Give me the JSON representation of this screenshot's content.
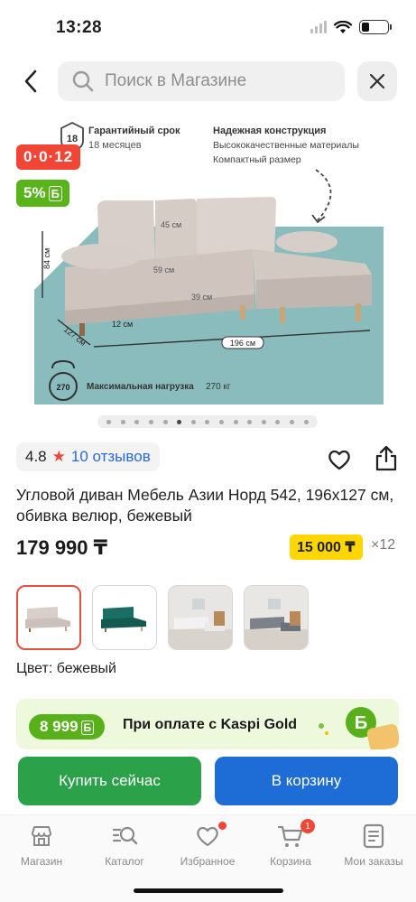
{
  "status_bar": {
    "time": "13:28"
  },
  "search": {
    "placeholder": "Поиск в Магазине"
  },
  "hero": {
    "installment_badge": "0·0·12",
    "bonus_badge": "5%",
    "bonus_symbol": "Б",
    "warranty_title": "Гарантийный срок",
    "warranty_value": "18 месяцев",
    "warranty_icon_text": "18",
    "construction_title": "Надежная конструкция",
    "construction_line1": "Высококачественные материалы",
    "construction_line2": "Компактный размер",
    "dim_height": "84 см",
    "dim_back": "45 см",
    "dim_seat_depth": "59 см",
    "dim_seat_height": "39 см",
    "dim_leg": "12 см",
    "dim_depth": "127 см",
    "dim_width": "196 см",
    "load_label": "Максимальная нагрузка",
    "load_value": "270 кг",
    "load_icon_text": "270",
    "slide_count": 15,
    "active_slide": 5
  },
  "rating": {
    "score": "4.8",
    "reviews": "10 отзывов"
  },
  "product": {
    "title": "Угловой диван Мебель Азии Норд 542, 196x127 см, обивка велюр, бежевый",
    "price": "179 990 ₸",
    "installment_amount": "15 000 ₸",
    "installment_months": "×12",
    "color_label": "Цвет: бежевый"
  },
  "thumbnails": [
    {
      "name": "beige",
      "selected": true
    },
    {
      "name": "green",
      "selected": false
    },
    {
      "name": "grey-room",
      "selected": false
    },
    {
      "name": "dark-room",
      "selected": false
    }
  ],
  "banner": {
    "amount": "8 999",
    "symbol": "Б",
    "text": "При оплате с Kaspi Gold"
  },
  "actions": {
    "buy_now": "Купить сейчас",
    "add_to_cart": "В корзину"
  },
  "tabbar": {
    "items": [
      {
        "label": "Магазин",
        "icon": "store-icon"
      },
      {
        "label": "Каталог",
        "icon": "catalog-search-icon"
      },
      {
        "label": "Избранное",
        "icon": "heart-icon"
      },
      {
        "label": "Корзина",
        "icon": "cart-icon",
        "count": "1"
      },
      {
        "label": "Мои заказы",
        "icon": "orders-icon"
      }
    ]
  },
  "colors": {
    "installment_red": "#f14635",
    "bonus_green": "#59b31b",
    "yellow": "#ffd600",
    "buy_green": "#2ba24a",
    "cart_blue": "#1e6dd6",
    "floor_teal": "#8bbcbd"
  }
}
